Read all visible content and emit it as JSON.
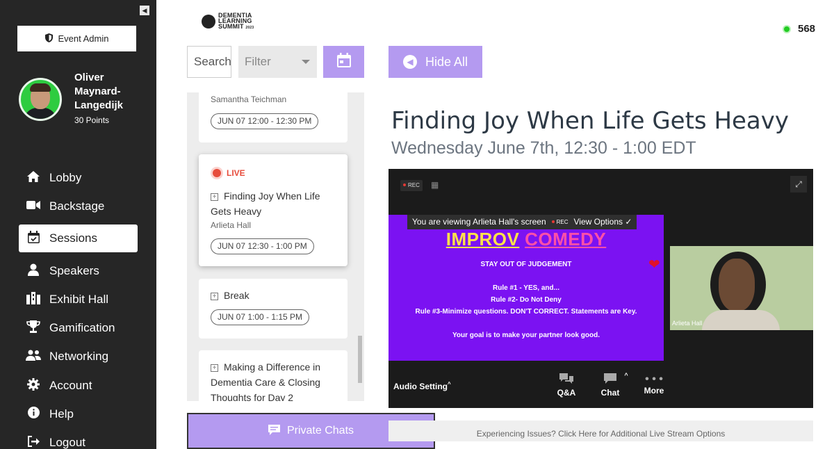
{
  "sidebar": {
    "collapse_icon": "◀",
    "event_admin_label": "Event Admin",
    "user": {
      "name": "Oliver Maynard-Langedijk",
      "points": "30 Points"
    },
    "nav": [
      {
        "label": "Lobby",
        "icon": "home-icon"
      },
      {
        "label": "Backstage",
        "icon": "video-camera-icon"
      },
      {
        "label": "Sessions",
        "icon": "calendar-check-icon",
        "active": true
      },
      {
        "label": "Speakers",
        "icon": "speaker-icon"
      },
      {
        "label": "Exhibit Hall",
        "icon": "exhibit-icon"
      },
      {
        "label": "Gamification",
        "icon": "trophy-icon"
      },
      {
        "label": "Networking",
        "icon": "people-icon"
      },
      {
        "label": "Account",
        "icon": "gear-icon"
      },
      {
        "label": "Help",
        "icon": "info-icon"
      },
      {
        "label": "Logout",
        "icon": "logout-icon"
      }
    ]
  },
  "header": {
    "logo_lines": [
      "DEMENTIA",
      "LEARNING",
      "SUMMIT"
    ],
    "logo_year": "2023",
    "online_count": "568",
    "online_color": "#22cc22"
  },
  "controls": {
    "search_placeholder": "Search",
    "filter_label": "Filter",
    "hide_all_label": "Hide All"
  },
  "sessions": [
    {
      "speaker": "Samantha Teichman",
      "time": "JUN 07 12:00 - 12:30 PM"
    },
    {
      "live_label": "LIVE",
      "title": "Finding Joy When Life Gets Heavy",
      "speaker": "Arlieta Hall",
      "time": "JUN 07 12:30 - 1:00 PM"
    },
    {
      "title": "Break",
      "time": "JUN 07 1:00 - 1:15 PM"
    },
    {
      "title": "Making a Difference in Dementia Care & Closing Thoughts for Day 2"
    }
  ],
  "private_chats_label": "Private Chats",
  "session": {
    "title": "Finding Joy When Life Gets Heavy",
    "time": "Wednesday June 7th, 12:30 - 1:00 EDT"
  },
  "video": {
    "rec_label": "REC",
    "viewing_text": "You are viewing Arlieta Hall's screen",
    "viewing_rec": "REC",
    "view_options": "View Options ✓",
    "slide": {
      "title_word1": "IMPROV",
      "title_word2": "COMEDY",
      "lines": [
        "STAY OUT OF JUDGEMENT",
        "",
        "Rule #1 - YES, and...",
        "Rule #2- Do Not Deny",
        "Rule #3-Minimize questions. DON'T CORRECT. Statements are Key.",
        "",
        "Your goal is to make your partner look good."
      ]
    },
    "participant_name": "Arlieta Hall",
    "audio_setting": "Audio Setting",
    "controls": [
      {
        "label": "Q&A",
        "icon": "qa-icon"
      },
      {
        "label": "Chat",
        "icon": "chat-icon"
      },
      {
        "label": "More",
        "icon": "more-icon"
      }
    ]
  },
  "issues_link": "Experiencing Issues? Click Here for Additional Live Stream Options",
  "colors": {
    "accent": "#b49af0",
    "sidebar": "#262626",
    "live": "#e74c3c",
    "slide": "#7b12f2"
  }
}
